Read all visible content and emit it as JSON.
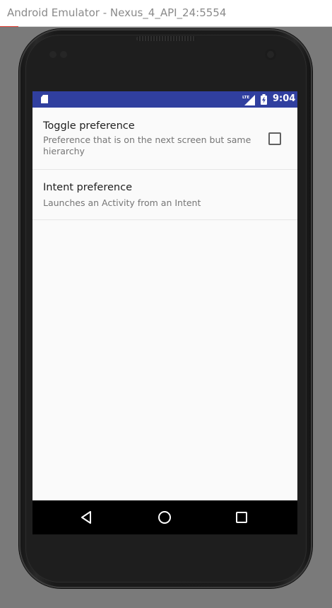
{
  "window": {
    "title": "Android Emulator - Nexus_4_API_24:5554"
  },
  "status_bar": {
    "time": "9:04",
    "network_label": "LTE",
    "background_color": "#303f9f",
    "icons": [
      "sd-card-icon",
      "lte-signal-icon",
      "battery-charging-icon"
    ]
  },
  "preferences": [
    {
      "title": "Toggle preference",
      "summary": "Preference that is on the next screen but same hierarchy",
      "widget": "checkbox",
      "checked": false
    },
    {
      "title": "Intent preference",
      "summary": "Launches an Activity from an Intent"
    }
  ],
  "navigation_bar": {
    "buttons": [
      "back-icon",
      "home-icon",
      "recents-icon"
    ]
  }
}
